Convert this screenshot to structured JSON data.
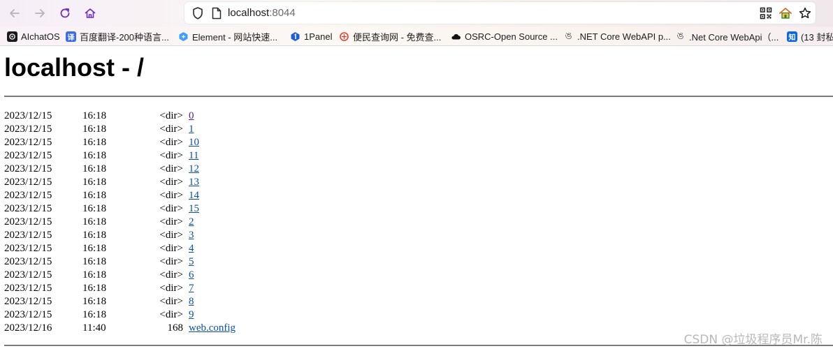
{
  "browser": {
    "url_host": "localhost",
    "url_port": ":8044",
    "bookmarks": [
      {
        "label": "AIchatOS",
        "icon": "chatgpt-logo-icon",
        "color": "#1a1a1a"
      },
      {
        "label": "百度翻译-200种语言...",
        "icon": "baidu-translate-icon",
        "color": "#3a6ee8",
        "glyph": "译"
      },
      {
        "label": "Element - 网站快速...",
        "icon": "element-logo-icon",
        "color": "#409eff"
      },
      {
        "label": "1Panel",
        "icon": "1panel-logo-icon",
        "color": "#1f5fd6"
      },
      {
        "label": "便民查询网 - 免费查...",
        "icon": "bianmin-logo-icon",
        "color": "#e0412c"
      },
      {
        "label": "OSRC-Open Source ...",
        "icon": "cloud-icon",
        "color": "#111111"
      },
      {
        "label": ".NET Core WebAPI p...",
        "icon": "csdn-style-icon",
        "color": "#444444"
      },
      {
        "label": ".Net Core WebApi（...",
        "icon": "csdn-style-icon",
        "color": "#444444"
      },
      {
        "label": "(13 封私",
        "icon": "zhihu-icon",
        "color": "#0a66e4",
        "glyph": "知"
      }
    ]
  },
  "page": {
    "title": "localhost - /",
    "entries": [
      {
        "date": "2023/12/15",
        "time": "16:18",
        "size": "<dir>",
        "name": "0",
        "visited": true
      },
      {
        "date": "2023/12/15",
        "time": "16:18",
        "size": "<dir>",
        "name": "1",
        "visited": false
      },
      {
        "date": "2023/12/15",
        "time": "16:18",
        "size": "<dir>",
        "name": "10",
        "visited": false
      },
      {
        "date": "2023/12/15",
        "time": "16:18",
        "size": "<dir>",
        "name": "11",
        "visited": false
      },
      {
        "date": "2023/12/15",
        "time": "16:18",
        "size": "<dir>",
        "name": "12",
        "visited": false
      },
      {
        "date": "2023/12/15",
        "time": "16:18",
        "size": "<dir>",
        "name": "13",
        "visited": false
      },
      {
        "date": "2023/12/15",
        "time": "16:18",
        "size": "<dir>",
        "name": "14",
        "visited": false
      },
      {
        "date": "2023/12/15",
        "time": "16:18",
        "size": "<dir>",
        "name": "15",
        "visited": false
      },
      {
        "date": "2023/12/15",
        "time": "16:18",
        "size": "<dir>",
        "name": "2",
        "visited": false
      },
      {
        "date": "2023/12/15",
        "time": "16:18",
        "size": "<dir>",
        "name": "3",
        "visited": false
      },
      {
        "date": "2023/12/15",
        "time": "16:18",
        "size": "<dir>",
        "name": "4",
        "visited": false
      },
      {
        "date": "2023/12/15",
        "time": "16:18",
        "size": "<dir>",
        "name": "5",
        "visited": false
      },
      {
        "date": "2023/12/15",
        "time": "16:18",
        "size": "<dir>",
        "name": "6",
        "visited": false
      },
      {
        "date": "2023/12/15",
        "time": "16:18",
        "size": "<dir>",
        "name": "7",
        "visited": false
      },
      {
        "date": "2023/12/15",
        "time": "16:18",
        "size": "<dir>",
        "name": "8",
        "visited": false
      },
      {
        "date": "2023/12/15",
        "time": "16:18",
        "size": "<dir>",
        "name": "9",
        "visited": false
      },
      {
        "date": "2023/12/16",
        "time": "11:40",
        "size": "168",
        "name": "web.config",
        "visited": false
      }
    ]
  },
  "watermark": "CSDN @垃圾程序员Mr.陈"
}
